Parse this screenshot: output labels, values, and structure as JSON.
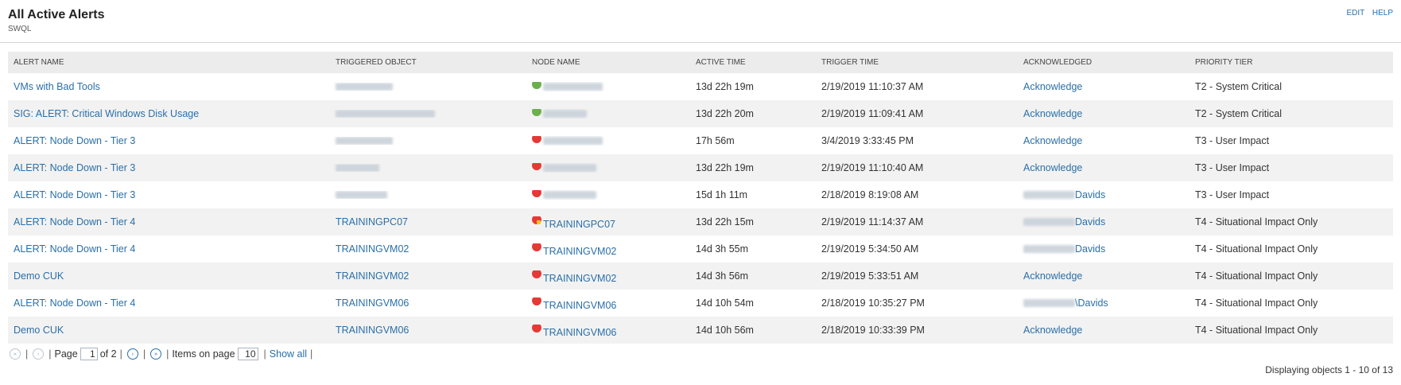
{
  "header": {
    "title": "All Active Alerts",
    "subtitle": "SWQL",
    "edit": "EDIT",
    "help": "HELP"
  },
  "columns": [
    "ALERT NAME",
    "TRIGGERED OBJECT",
    "NODE NAME",
    "ACTIVE TIME",
    "TRIGGER TIME",
    "ACKNOWLEDGED",
    "PRIORITY TIER"
  ],
  "rows": [
    {
      "alert": "VMs with Bad Tools",
      "object": "",
      "node": "",
      "node_status": "up",
      "active": "13d 22h 19m",
      "trigger": "2/19/2019 11:10:37 AM",
      "ack": "Acknowledge",
      "tier": "T2 - System Critical"
    },
    {
      "alert": "SIG: ALERT: Critical Windows Disk Usage",
      "object": "",
      "node": "",
      "node_status": "up",
      "active": "13d 22h 20m",
      "trigger": "2/19/2019 11:09:41 AM",
      "ack": "Acknowledge",
      "tier": "T2 - System Critical"
    },
    {
      "alert": "ALERT: Node Down - Tier 3",
      "object": "",
      "node": "",
      "node_status": "down",
      "active": "17h 56m",
      "trigger": "3/4/2019 3:33:45 PM",
      "ack": "Acknowledge",
      "tier": "T3 - User Impact"
    },
    {
      "alert": "ALERT: Node Down - Tier 3",
      "object": "",
      "node": "",
      "node_status": "down",
      "active": "13d 22h 19m",
      "trigger": "2/19/2019 11:10:40 AM",
      "ack": "Acknowledge",
      "tier": "T3 - User Impact"
    },
    {
      "alert": "ALERT: Node Down - Tier 3",
      "object": "",
      "node": "",
      "node_status": "down",
      "active": "15d 1h 11m",
      "trigger": "2/18/2019 8:19:08 AM",
      "ack": "Davids",
      "tier": "T3 - User Impact"
    },
    {
      "alert": "ALERT: Node Down - Tier 4",
      "object": "TRAININGPC07",
      "node": "TRAININGPC07",
      "node_status": "down-warning",
      "active": "13d 22h 15m",
      "trigger": "2/19/2019 11:14:37 AM",
      "ack": "Davids",
      "tier": "T4 - Situational Impact Only"
    },
    {
      "alert": "ALERT: Node Down - Tier 4",
      "object": "TRAININGVM02",
      "node": "TRAININGVM02",
      "node_status": "down",
      "active": "14d 3h 55m",
      "trigger": "2/19/2019 5:34:50 AM",
      "ack": "Davids",
      "tier": "T4 - Situational Impact Only"
    },
    {
      "alert": "Demo CUK",
      "object": "TRAININGVM02",
      "node": "TRAININGVM02",
      "node_status": "down",
      "active": "14d 3h 56m",
      "trigger": "2/19/2019 5:33:51 AM",
      "ack": "Acknowledge",
      "tier": "T4 - Situational Impact Only"
    },
    {
      "alert": "ALERT: Node Down - Tier 4",
      "object": "TRAININGVM06",
      "node": "TRAININGVM06",
      "node_status": "down",
      "active": "14d 10h 54m",
      "trigger": "2/18/2019 10:35:27 PM",
      "ack": "\\Davids",
      "tier": "T4 - Situational Impact Only"
    },
    {
      "alert": "Demo CUK",
      "object": "TRAININGVM06",
      "node": "TRAININGVM06",
      "node_status": "down",
      "active": "14d 10h 56m",
      "trigger": "2/18/2019 10:33:39 PM",
      "ack": "Acknowledge",
      "tier": "T4 - Situational Impact Only"
    }
  ],
  "pager": {
    "page_label": "Page",
    "page_value": "1",
    "of_label": "of 2",
    "items_label": "Items on page",
    "items_value": "10",
    "show_all": "Show all",
    "status": "Displaying objects 1 - 10 of 13"
  },
  "colors": {
    "link": "#2a6fa8",
    "up": "#6ab04c",
    "down": "#e53935",
    "warning": "#f5c518",
    "header_bg": "#ececec",
    "alt_row_bg": "#f2f2f2"
  }
}
